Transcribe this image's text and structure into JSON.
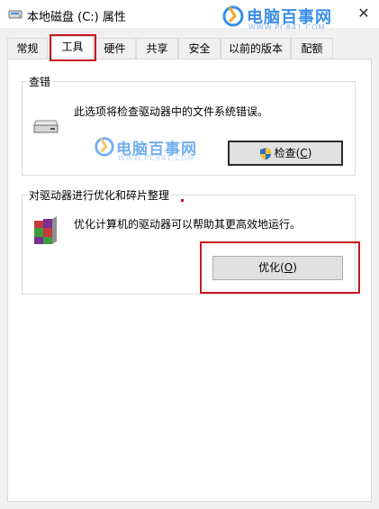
{
  "window": {
    "title": "本地磁盘 (C:) 属性",
    "close_glyph": "✕"
  },
  "watermark": {
    "name": "电脑百事网",
    "url": "WWW.PC841.COM"
  },
  "tabs": [
    {
      "label": "常规",
      "active": false
    },
    {
      "label": "工具",
      "active": true
    },
    {
      "label": "硬件",
      "active": false
    },
    {
      "label": "共享",
      "active": false
    },
    {
      "label": "安全",
      "active": false
    },
    {
      "label": "以前的版本",
      "active": false
    },
    {
      "label": "配额",
      "active": false
    }
  ],
  "error_check": {
    "group_title": "查错",
    "description": "此选项将检查驱动器中的文件系统错误。",
    "button_label": "检查(",
    "button_key": "C",
    "button_close": ")",
    "icon": "drive-icon"
  },
  "optimize": {
    "group_title": "对驱动器进行优化和碎片整理",
    "description": "优化计算机的驱动器可以帮助其更高效地运行。",
    "button_label": "优化(",
    "button_key": "O",
    "button_close": ")",
    "icon": "defrag-icon"
  },
  "colors": {
    "highlight": "#c8161d",
    "watermark": "#3a8ee6"
  }
}
